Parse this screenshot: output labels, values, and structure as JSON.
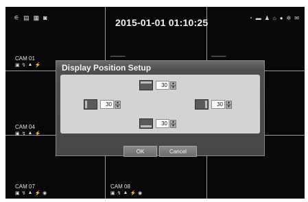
{
  "clock": "2015-01-01 01:10:25",
  "status_icons_left": [
    "motion-icon",
    "hdd-icon",
    "network-icon",
    "record-icon"
  ],
  "status_icons_right": [
    "search-icon",
    "hdd-icon",
    "user-icon",
    "lock-icon",
    "zoom-icon",
    "gear-icon",
    "mail-icon"
  ],
  "cameras": {
    "cam01": "CAM 01",
    "cam04": "CAM 04",
    "cam07": "CAM 07",
    "cam08": "CAM 08"
  },
  "camera_status_icons": [
    "rec-icon",
    "motion-icon",
    "lock-icon",
    "sensor-icon",
    "event-icon"
  ],
  "dialog": {
    "title": "Display Position Setup",
    "top_value": "30",
    "left_value": "30",
    "right_value": "30",
    "bottom_value": "30",
    "ok_label": "OK",
    "cancel_label": "Cancel"
  }
}
